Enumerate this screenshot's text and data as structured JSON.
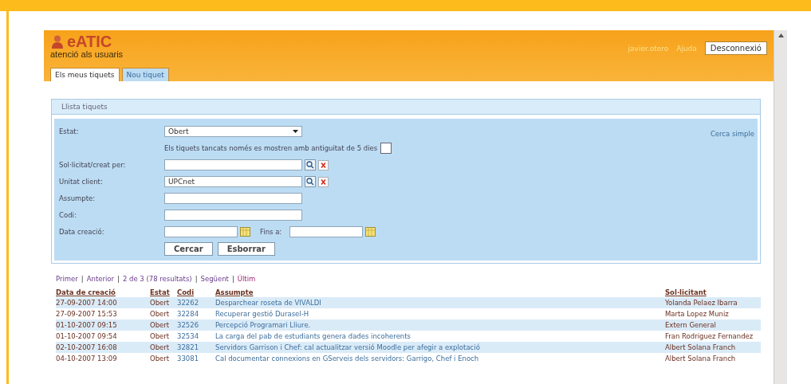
{
  "header": {
    "logo_title": "eATIC",
    "logo_subtitle": "atenció als usuaris",
    "user": "javier.otero",
    "help": "Ajuda",
    "logout": "Desconnexió"
  },
  "tabs": [
    {
      "label": "Els meus tiquets",
      "selected": true
    },
    {
      "label": "Nou tiquet",
      "selected": false
    }
  ],
  "panel": {
    "title": "Llista tiquets",
    "simple_search": "Cerca simple",
    "form": [
      {
        "kind": "select",
        "label": "Estat:",
        "value": "Obert"
      },
      {
        "kind": "note",
        "text": "Els tiquets tancats només es mostren amb antiguitat de 5 dies",
        "checked": false
      },
      {
        "kind": "lookup",
        "label": "Sol·licitat/creat per:"
      },
      {
        "kind": "lookup",
        "label": "Unitat client:",
        "value": "UPCnet"
      },
      {
        "kind": "text",
        "label": "Assumpte:"
      },
      {
        "kind": "text",
        "label": "Codi:"
      },
      {
        "kind": "daterange",
        "label": "Data creació:",
        "to_label": "Fins a:"
      }
    ],
    "buttons": [
      "Cercar",
      "Esborrar"
    ]
  },
  "pagination": [
    {
      "label": "Primer",
      "kind": "link",
      "separator": "|"
    },
    {
      "label": "Anterior",
      "kind": "link",
      "separator": "|"
    },
    {
      "label": "2 de 3 (78 resultats)",
      "kind": "text",
      "separator": "|"
    },
    {
      "label": "Següent",
      "kind": "link",
      "separator": "|"
    },
    {
      "label": "Últim",
      "kind": "last"
    }
  ],
  "table": {
    "columns": [
      "Data de creació",
      "Estat",
      "Codi",
      "Assumpte",
      "Sol·licitant"
    ],
    "rows": [
      [
        "27-09-2007 14:00",
        "Obert",
        "32262",
        "Desparchear roseta de VIVALDI",
        "Yolanda Pelaez Ibarra"
      ],
      [
        "27-09-2007 15:53",
        "Obert",
        "32284",
        "Recuperar gestió Durasel-H",
        "Marta Lopez Muniz"
      ],
      [
        "01-10-2007 09:15",
        "Obert",
        "32526",
        "Percepció Programari Lliure.",
        "Extern General"
      ],
      [
        "01-10-2007 09:54",
        "Obert",
        "32534",
        "La carga del pab de estudiants genera dades incoherents",
        "Fran Rodriguez Fernandez"
      ],
      [
        "02-10-2007 16:08",
        "Obert",
        "32821",
        "Servidors Garrison i Chef: cal actualitzar versió Moodle per afegir a explotació",
        "Albert Solana Franch"
      ],
      [
        "04-10-2007 13:09",
        "Obert",
        "33081",
        "Cal documentar connexions en GServeis dels servidors: Garrigo, Chef i Enoch",
        "Albert Solana Franch"
      ]
    ]
  }
}
